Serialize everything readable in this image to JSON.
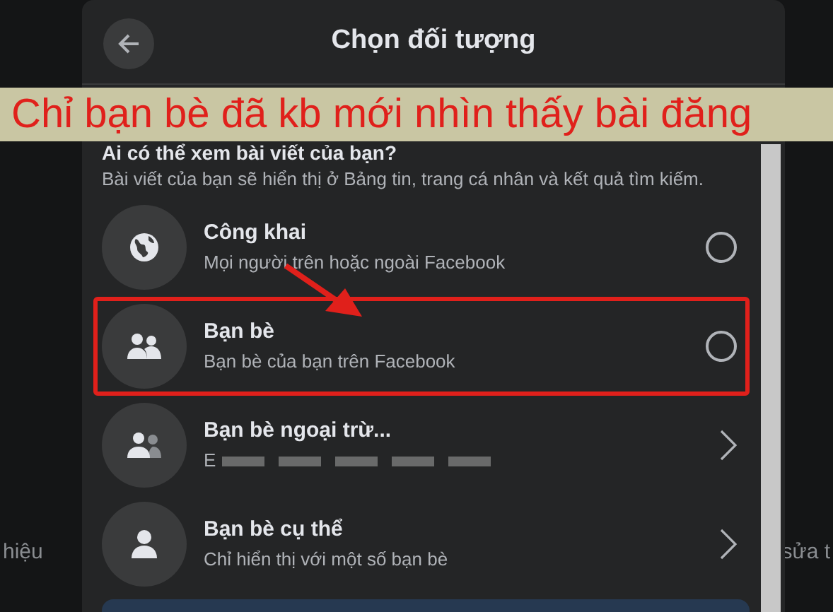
{
  "backdrop": {
    "left_text": "hiệu",
    "right_text": "sửa t"
  },
  "dialog": {
    "title": "Chọn đối tượng",
    "heading": "Ai có thể xem bài viết của bạn?",
    "description": "Bài viết của bạn sẽ hiển thị ở Bảng tin, trang cá nhân và kết quả tìm kiếm."
  },
  "options": [
    {
      "kind": "radio",
      "title": "Công khai",
      "subtitle": "Mọi người trên hoặc ngoài Facebook",
      "selected": false,
      "highlighted": false
    },
    {
      "kind": "radio",
      "title": "Bạn bè",
      "subtitle": "Bạn bè của bạn trên Facebook",
      "selected": false,
      "highlighted": true
    },
    {
      "kind": "submenu",
      "title": "Bạn bè ngoại trừ...",
      "subtitle": "E",
      "highlighted": false
    },
    {
      "kind": "submenu",
      "title": "Bạn bè cụ thể",
      "subtitle": "Chỉ hiển thị với một số bạn bè",
      "highlighted": false
    }
  ],
  "annotation": {
    "text": "Chỉ bạn bè đã kb mới nhìn thấy bài đăng",
    "arrow": true
  }
}
